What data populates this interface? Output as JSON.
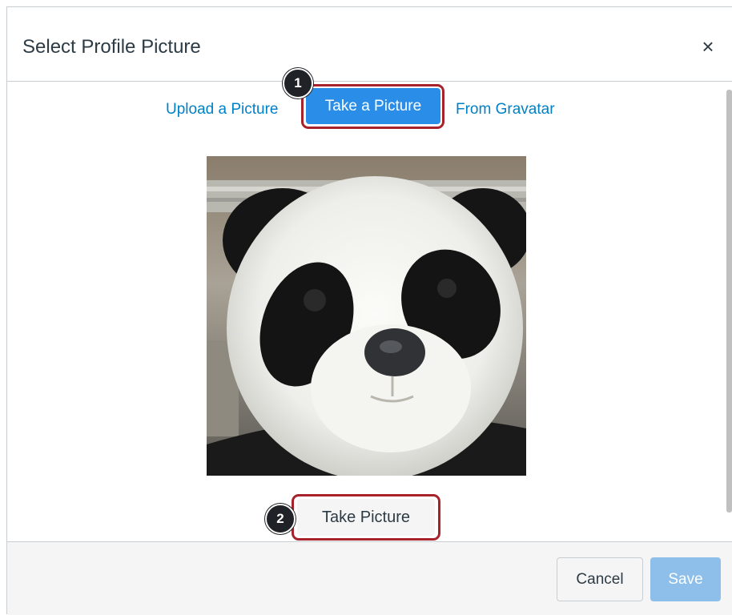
{
  "dialog": {
    "title": "Select Profile Picture",
    "close_icon": "×"
  },
  "tabs": [
    {
      "label": "Upload a Picture",
      "active": false
    },
    {
      "label": "Take a Picture",
      "active": true
    },
    {
      "label": "From Gravatar",
      "active": false
    }
  ],
  "annotations": {
    "step1": "1",
    "step2": "2"
  },
  "camera": {
    "preview_subject": "panda-plush-webcam-preview"
  },
  "actions": {
    "take_picture_label": "Take Picture",
    "cancel_label": "Cancel",
    "save_label": "Save"
  },
  "colors": {
    "link": "#0081c6",
    "active_tab": "#2a8de8",
    "highlight": "#a8222c",
    "save_disabled": "#8dbfea"
  }
}
